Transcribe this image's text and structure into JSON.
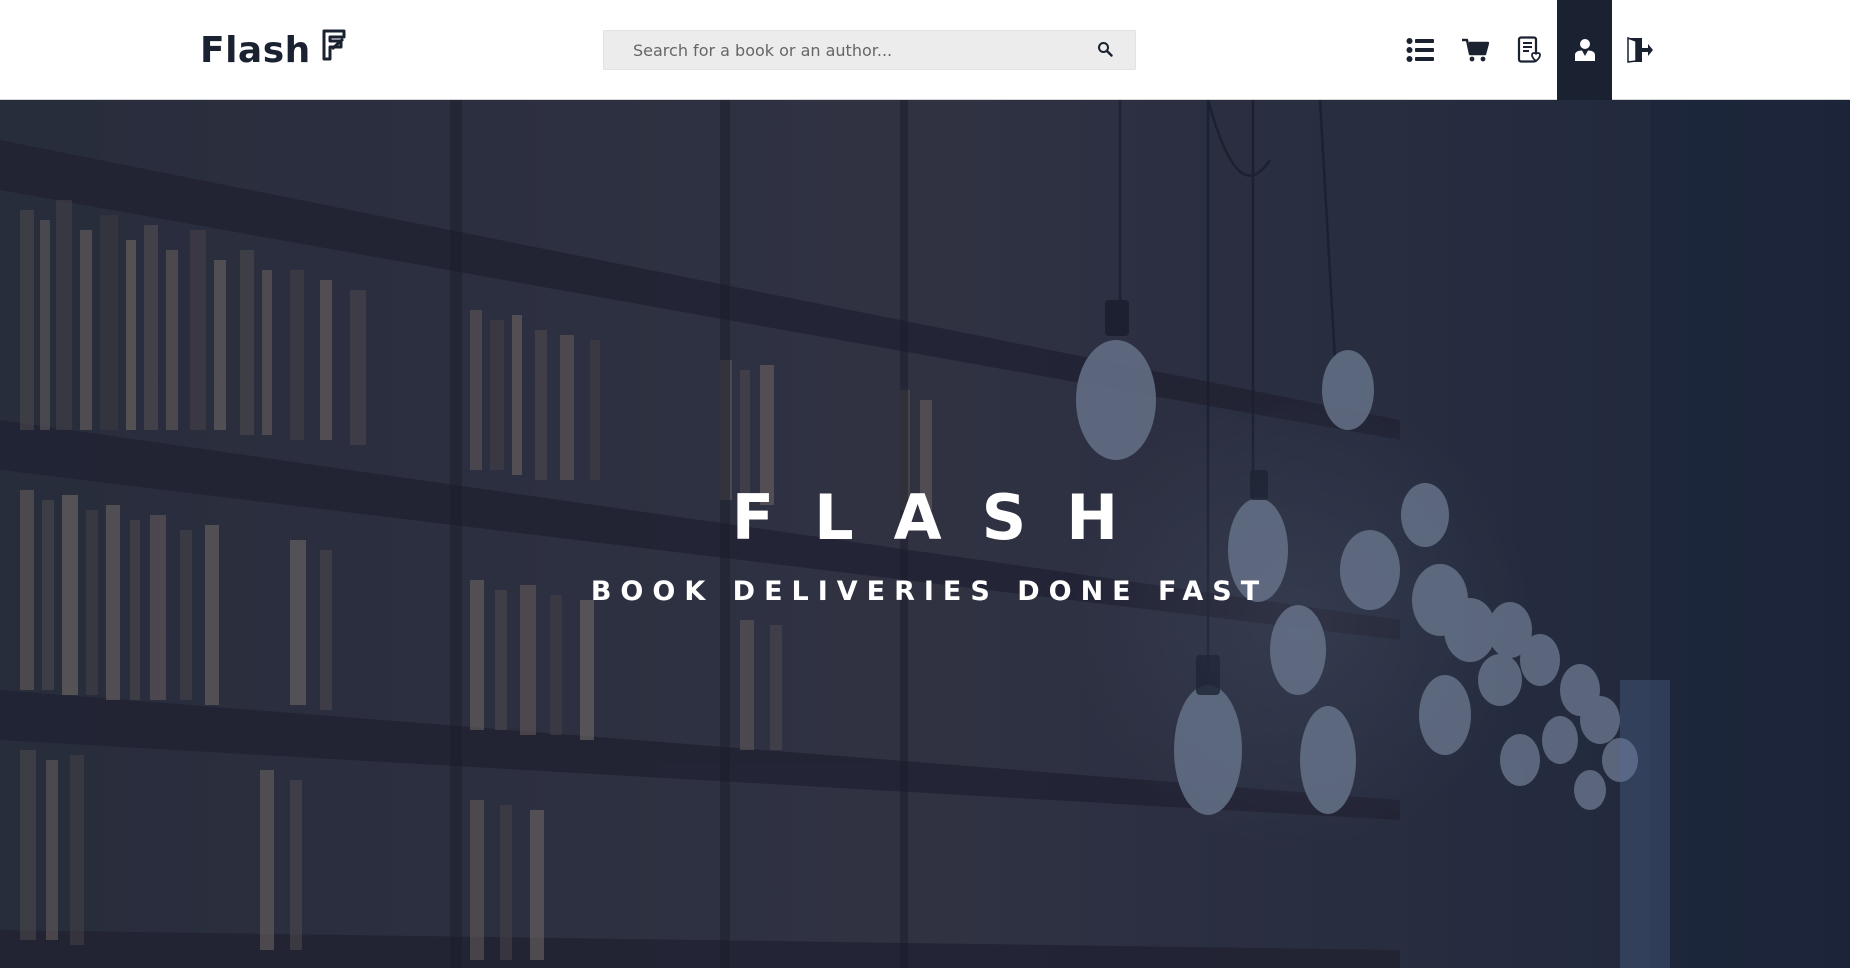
{
  "brand": {
    "name": "Flash"
  },
  "search": {
    "placeholder": "Search for a book or an author..."
  },
  "nav": {
    "items": [
      {
        "icon": "list-icon",
        "active": false
      },
      {
        "icon": "cart-icon",
        "active": false
      },
      {
        "icon": "receipt-icon",
        "active": false
      },
      {
        "icon": "user-icon",
        "active": true
      },
      {
        "icon": "logout-icon",
        "active": false
      }
    ]
  },
  "hero": {
    "title": "FLASH",
    "subtitle": "BOOK DELIVERIES DONE FAST"
  },
  "colors": {
    "brand_dark": "#1a2231",
    "hero_overlay": "#1e2a44",
    "search_bg": "#ececec"
  }
}
